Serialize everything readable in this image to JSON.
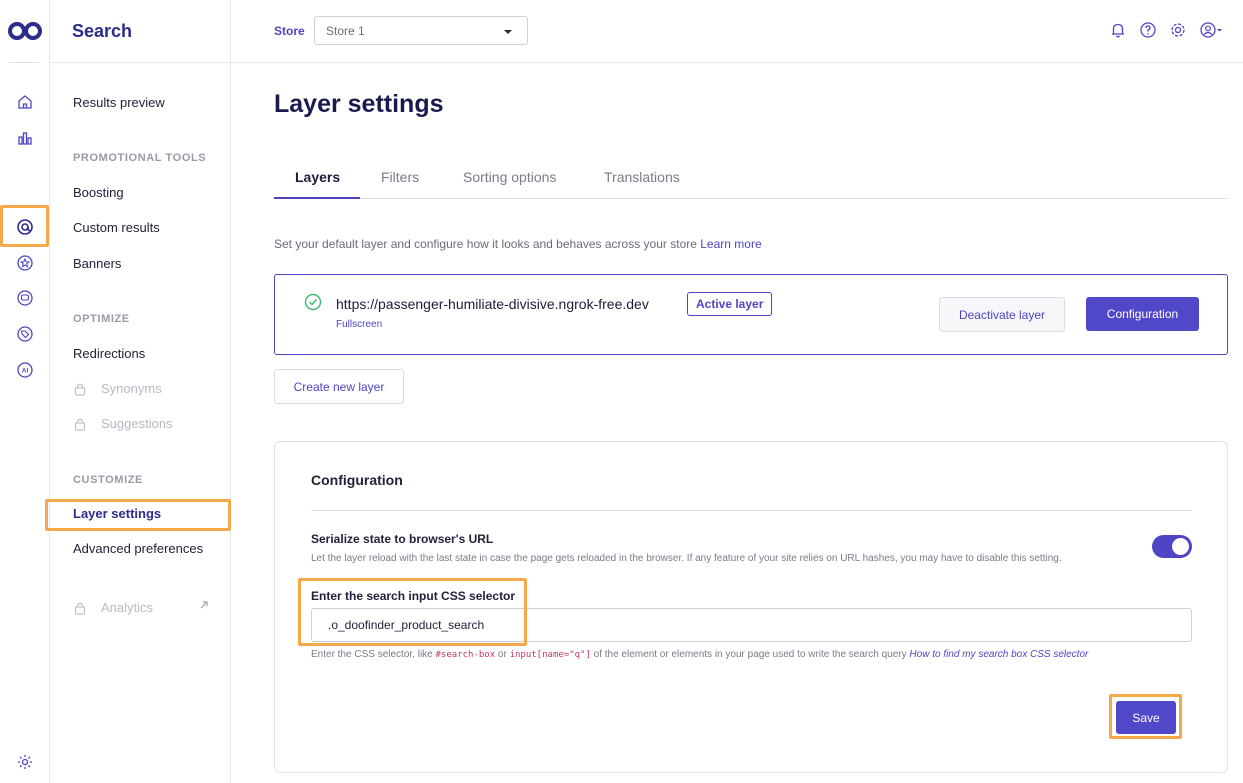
{
  "brand": {
    "accent": "#5147c9",
    "highlight": "#f5a94a"
  },
  "rail": {
    "icons": [
      "logo-icon",
      "home-icon",
      "bar-chart-icon",
      "search-at-icon",
      "star-badge-icon",
      "chat-icon",
      "tag-icon",
      "ai-icon",
      "settings-icon"
    ]
  },
  "sidebar": {
    "title": "Search",
    "results_preview": "Results preview",
    "sections": {
      "promotional": "PROMOTIONAL TOOLS",
      "optimize": "OPTIMIZE",
      "customize": "CUSTOMIZE"
    },
    "items": {
      "boosting": "Boosting",
      "custom_results": "Custom results",
      "banners": "Banners",
      "redirections": "Redirections",
      "synonyms": "Synonyms",
      "suggestions": "Suggestions",
      "layer_settings": "Layer settings",
      "advanced_preferences": "Advanced preferences",
      "analytics": "Analytics"
    }
  },
  "topbar": {
    "store_label": "Store",
    "store_value": "Store 1"
  },
  "main": {
    "title": "Layer settings",
    "tabs": [
      "Layers",
      "Filters",
      "Sorting options",
      "Translations"
    ],
    "intro": "Set your default layer and configure how it looks and behaves across your store",
    "intro_link": "Learn more",
    "layer": {
      "url": "https://passenger-humiliate-divisive.ngrok-free.dev",
      "type": "Fullscreen",
      "badge": "Active layer",
      "deactivate": "Deactivate layer",
      "configuration": "Configuration"
    },
    "create_new": "Create new layer",
    "config": {
      "title": "Configuration",
      "serialize_title": "Serialize state to browser's URL",
      "serialize_desc": "Let the layer reload with the last state in case the page gets reloaded in the browser. If any feature of your site relies on URL hashes, you may have to disable this setting.",
      "serialize_on": true,
      "selector_label": "Enter the search input CSS selector",
      "selector_value": ".o_doofinder_product_search",
      "help_pre": "Enter the CSS selector, like",
      "help_code1": "#search-box",
      "help_or": "or",
      "help_code2": "input[name=\"q\"]",
      "help_post": "of the element or elements in your page used to write the search query",
      "help_link": "How to find my search box CSS selector",
      "save": "Save"
    }
  }
}
